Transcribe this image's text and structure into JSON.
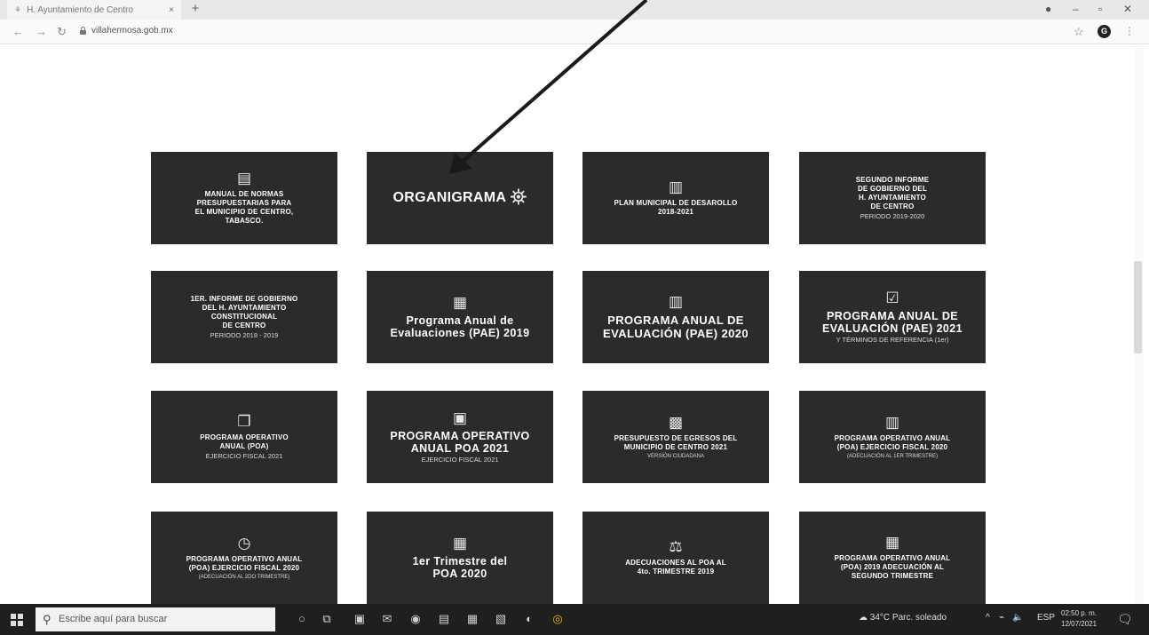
{
  "browser": {
    "tab_title": "H. Ayuntamiento de Centro",
    "tab_close": "×",
    "new_tab": "+",
    "url": "villahermosa.gob.mx",
    "profile_initial": "G"
  },
  "cards": [
    {
      "lines": [
        "MANUAL DE NORMAS",
        "PRESUPUESTARIAS PARA",
        "EL MUNICIPIO DE CENTRO,",
        "TABASCO."
      ],
      "sub": "",
      "icon": "document-icon"
    },
    {
      "lines": [
        "ORGANIGRAMA"
      ],
      "sub": "",
      "icon": "org-chart-icon"
    },
    {
      "lines": [
        "PLAN MUNICIPAL DE DESAROLLO",
        "2018-2021"
      ],
      "sub": "",
      "icon": "book-icon"
    },
    {
      "lines": [
        "SEGUNDO INFORME",
        "DE GOBIERNO DEL",
        "H. AYUNTAMIENTO",
        "DE CENTRO"
      ],
      "sub": "PERIODO 2019-2020",
      "icon": ""
    },
    {
      "lines": [
        "1ER. INFORME DE GOBIERNO",
        "DEL H. AYUNTAMIENTO",
        "CONSTITUCIONAL",
        "DE CENTRO"
      ],
      "sub": "PERIODO 2018 - 2019",
      "icon": ""
    },
    {
      "lines": [
        "Programa Anual de",
        "Evaluaciones (PAE) 2019"
      ],
      "sub": "",
      "icon": "clipboard-icon"
    },
    {
      "lines": [
        "PROGRAMA ANUAL DE",
        "EVALUACIÓN (PAE) 2020"
      ],
      "sub": "",
      "icon": "book-icon"
    },
    {
      "lines": [
        "PROGRAMA ANUAL DE",
        "EVALUACIÓN (PAE) 2021"
      ],
      "sub": "Y TÉRMINOS DE REFERENCIA (1er)",
      "icon": "checklist-icon"
    },
    {
      "lines": [
        "PROGRAMA OPERATIVO",
        "ANUAL (POA)"
      ],
      "sub": "EJERCICIO FISCAL 2021",
      "icon": "documents-icon"
    },
    {
      "lines": [
        "PROGRAMA OPERATIVO",
        "ANUAL POA 2021"
      ],
      "sub": "EJERCICIO FISCAL 2021",
      "icon": "monitor-icon"
    },
    {
      "lines": [
        "PRESUPUESTO DE EGRESOS DEL",
        "MUNICIPIO DE CENTRO 2021"
      ],
      "sub": "VERSIÓN CIUDADANA",
      "icon": "calculator-icon"
    },
    {
      "lines": [
        "PROGRAMA OPERATIVO ANUAL",
        "(POA) EJERCICIO FISCAL 2020"
      ],
      "sub": "(ADECUACIÓN AL 1ER TRIMESTRE)",
      "icon": "book-icon"
    },
    {
      "lines": [
        "PROGRAMA OPERATIVO ANUAL",
        "(POA) EJERCICIO FISCAL 2020"
      ],
      "sub": "(ADECUACIÓN AL 2DO TRIMESTRE)",
      "icon": "clock-document-icon"
    },
    {
      "lines": [
        "1er Trimestre del",
        "POA 2020"
      ],
      "sub": "",
      "icon": "clipboard-icon"
    },
    {
      "lines": [
        "ADECUACIONES AL POA AL",
        "4to. TRIMESTRE 2019"
      ],
      "sub": "",
      "icon": "money-chart-icon"
    },
    {
      "lines": [
        "PROGRAMA OPERATIVO ANUAL",
        "(POA) 2019 ADECUACIÓN AL",
        "SEGUNDO TRIMESTRE"
      ],
      "sub": "",
      "icon": "clipboard-icon"
    }
  ],
  "taskbar": {
    "search_placeholder": "Escribe aquí para buscar",
    "weather": "34°C  Parc. soleado",
    "language": "ESP",
    "time": "02:50 p. m.",
    "date": "12/07/2021"
  }
}
